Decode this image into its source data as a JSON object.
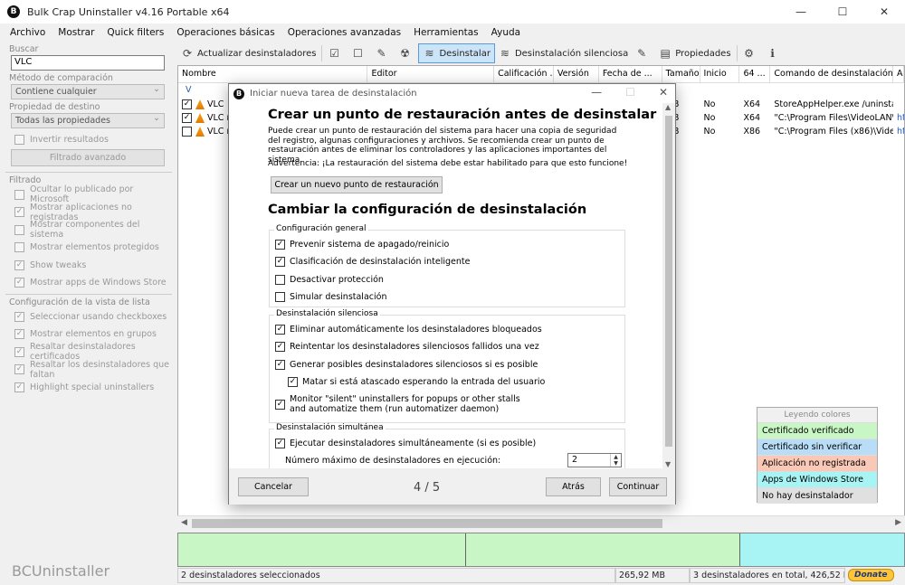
{
  "window": {
    "title": "Bulk Crap Uninstaller v4.16 Portable x64",
    "logo": "B",
    "controls": [
      "—",
      "☐",
      "✕"
    ]
  },
  "menu": [
    "Archivo",
    "Mostrar",
    "Quick filters",
    "Operaciones básicas",
    "Operaciones avanzadas",
    "Herramientas",
    "Ayuda"
  ],
  "left": {
    "search_label": "Buscar",
    "search_value": "VLC",
    "comparison_label": "Método de comparación",
    "comparison_value": "Contiene cualquier",
    "target_label": "Propiedad de destino",
    "target_value": "Todas las propiedades",
    "invert_label": "Invertir resultados",
    "advanced_filter": "Filtrado avanzado",
    "filter_label": "Filtrado",
    "filters": [
      {
        "label": "Ocultar lo publicado por Microsoft",
        "checked": false
      },
      {
        "label": "Mostrar aplicaciones no registradas",
        "checked": true
      },
      {
        "label": "Mostrar componentes del sistema",
        "checked": false
      },
      {
        "label": "Mostrar elementos protegidos",
        "checked": false
      },
      {
        "label": "Show tweaks",
        "checked": true
      },
      {
        "label": "Mostrar apps de Windows Store",
        "checked": true
      }
    ],
    "view_label": "Configuración de la vista de lista",
    "view_options": [
      {
        "label": "Seleccionar usando checkboxes",
        "checked": true
      },
      {
        "label": "Mostrar elementos en grupos",
        "checked": true
      },
      {
        "label": "Resaltar desinstaladores certificados",
        "checked": true
      },
      {
        "label": "Resaltar los desinstaladores que faltan",
        "checked": true
      },
      {
        "label": "Highlight special uninstallers",
        "checked": true
      }
    ],
    "brand": "BCUninstaller"
  },
  "toolbar": {
    "refresh": "Actualizar desinstaladores",
    "uninstall": "Desinstalar",
    "quiet": "Desinstalación silenciosa",
    "properties": "Propiedades"
  },
  "list": {
    "columns": [
      "Nombre",
      "Editor",
      "Calificación ...",
      "Versión",
      "Fecha de ...",
      "Tamaño",
      "Inicio",
      "64 ...",
      "Comando de desinstalación",
      "A"
    ],
    "group": "V",
    "rows": [
      {
        "name": "VLC",
        "size": "MB",
        "startup": "No",
        "arch": "X64",
        "command": "StoreAppHelper.exe /uninstall ...",
        "extra": "",
        "checked": true
      },
      {
        "name": "VLC m",
        "size": "MB",
        "startup": "No",
        "arch": "X64",
        "command": "\"C:\\Program Files\\VideoLAN\\...",
        "extra": "htt",
        "checked": true
      },
      {
        "name": "VLC m",
        "size": "MB",
        "startup": "No",
        "arch": "X86",
        "command": "\"C:\\Program Files (x86)\\Video...",
        "extra": "htt",
        "checked": false
      }
    ]
  },
  "legend": {
    "title": "Leyendo colores",
    "items": [
      {
        "label": "Certificado verificado",
        "color": "#c8f7c5"
      },
      {
        "label": "Certificado sin verificar",
        "color": "#b9dcf7"
      },
      {
        "label": "Aplicación no registrada",
        "color": "#f9c8b6"
      },
      {
        "label": "Apps de Windows Store",
        "color": "#a8f4f4"
      },
      {
        "label": "No hay desinstalador",
        "color": "#e0e0e0"
      }
    ]
  },
  "status": {
    "selected": "2 desinstaladores seleccionados",
    "selected_size": "265,92 MB",
    "total": "3 desinstaladores en total, 426,52 MB",
    "donate": "Donate"
  },
  "dialog": {
    "title": "Iniciar nueva tarea de desinstalación",
    "heading1": "Crear un punto de restauración antes de desinstalar",
    "paragraph": "Puede crear un punto de restauración del sistema para hacer una copia de seguridad del registro, algunas configuraciones y archivos. Se recomienda crear un punto de restauración antes de eliminar los controladores y las aplicaciones importantes del sistema.",
    "warning": "Advertencia: ¡La restauración del sistema debe estar habilitado para que esto funcione!",
    "restore_button": "Crear un nuevo punto de restauración",
    "heading2": "Cambiar la configuración de desinstalación",
    "general": {
      "legend": "Configuración general",
      "options": [
        {
          "label": "Prevenir sistema de apagado/reinicio",
          "checked": true
        },
        {
          "label": "Clasificación de desinstalación inteligente",
          "checked": true
        },
        {
          "label": "Desactivar protección",
          "checked": false
        },
        {
          "label": "Simular desinstalación",
          "checked": false
        }
      ]
    },
    "quiet": {
      "legend": "Desinstalación silenciosa",
      "options": [
        {
          "label": "Eliminar automáticamente los desinstaladores bloqueados",
          "checked": true
        },
        {
          "label": "Reintentar los desinstaladores silenciosos fallidos una vez",
          "checked": true
        },
        {
          "label": "Generar posibles desinstaladores silenciosos si es posible",
          "checked": true
        },
        {
          "label": "Matar si está atascado esperando la entrada del usuario",
          "checked": true
        }
      ],
      "monitor_line1": "Monitor \"silent\" uninstallers for popups or other stalls",
      "monitor_line2": "and automatize them (run automatizer daemon)",
      "monitor_checked": true
    },
    "simultaneous": {
      "legend": "Desinstalación simultánea",
      "option": "Ejecutar desinstaladores simultáneamente (si es posible)",
      "option_checked": true,
      "max_label": "Número máximo de desinstaladores en ejecución:",
      "max_value": "2"
    },
    "cancel": "Cancelar",
    "pager": "4 / 5",
    "back": "Atrás",
    "next": "Continuar"
  }
}
